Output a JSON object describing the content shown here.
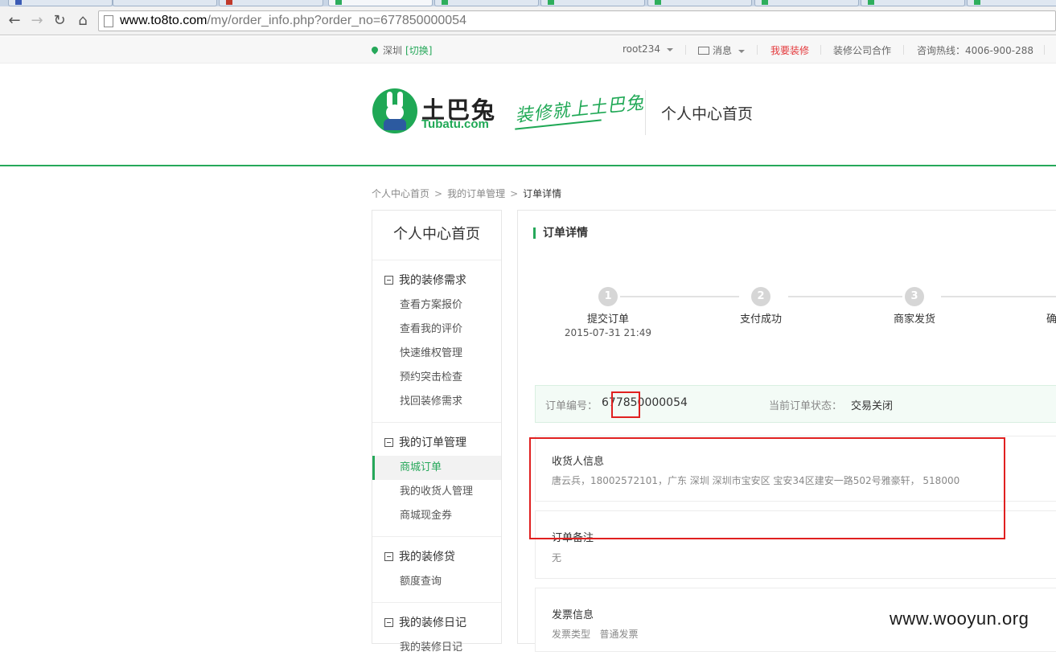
{
  "browser": {
    "url_host": "www.to8to.com",
    "url_path": "/my/order_info.php?order_no=677850000054"
  },
  "topbar": {
    "city": "深圳",
    "city_switch": "[切换]",
    "user": "root234",
    "messages": "消息",
    "decorate": "我要装修",
    "cooperate": "装修公司合作",
    "hotline": "咨询热线：4006-900-288"
  },
  "header": {
    "logo_cn": "土巴兔",
    "logo_en": "Tubatu.com",
    "slogan": "装修就上土巴兔",
    "title": "个人中心首页"
  },
  "breadcrumb": [
    "个人中心首页",
    "我的订单管理",
    "订单详情"
  ],
  "sidebar": {
    "title": "个人中心首页",
    "groups": [
      {
        "label": "我的装修需求",
        "items": [
          "查看方案报价",
          "查看我的评价",
          "快速维权管理",
          "预约突击检查",
          "找回装修需求"
        ]
      },
      {
        "label": "我的订单管理",
        "items": [
          "商城订单",
          "我的收货人管理",
          "商城现金券"
        ],
        "active": "商城订单"
      },
      {
        "label": "我的装修贷",
        "items": [
          "额度查询"
        ]
      },
      {
        "label": "我的装修日记",
        "items": [
          "我的装修日记"
        ]
      }
    ]
  },
  "main": {
    "title": "订单详情",
    "steps": [
      {
        "num": "1",
        "label": "提交订单",
        "time": "2015-07-31 21:49"
      },
      {
        "num": "2",
        "label": "支付成功"
      },
      {
        "num": "3",
        "label": "商家发货"
      },
      {
        "label": "确"
      }
    ],
    "order_no_label": "订单编号：",
    "order_no": "677850000054",
    "status_label": "当前订单状态：",
    "status": "交易关闭",
    "receiver_title": "收货人信息",
    "receiver_detail": "唐云兵，18002572101，广东 深圳 深圳市宝安区 宝安34区建安一路502号雅豪轩， 518000",
    "remark_title": "订单备注",
    "remark": "无",
    "invoice_title": "发票信息",
    "invoice_type_label": "发票类型",
    "invoice_type": "普通发票"
  },
  "watermark": "www.wooyun.org",
  "colors": {
    "brand_green": "#26a85a",
    "highlight_red": "#e02020"
  }
}
